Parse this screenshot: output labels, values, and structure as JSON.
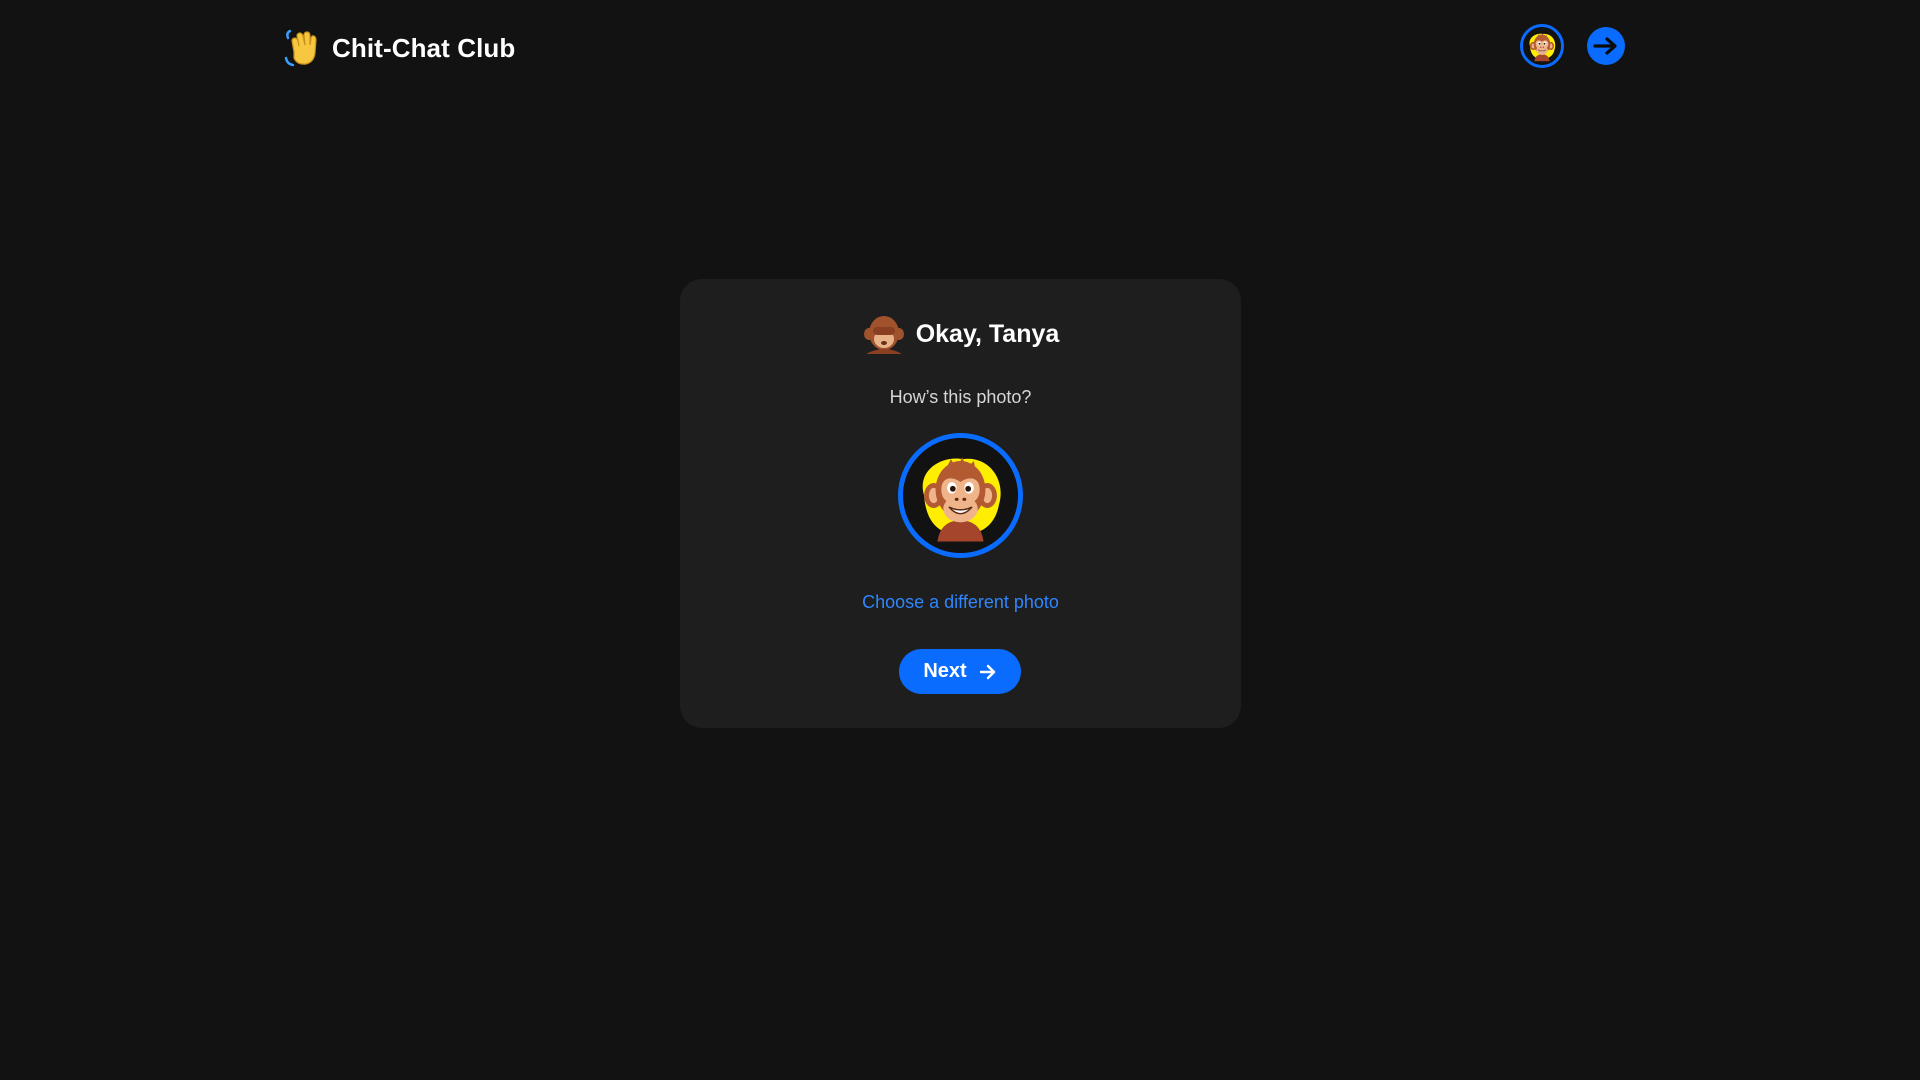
{
  "app": {
    "title": "Chit-Chat Club",
    "logo_icon": "waving-hand-icon"
  },
  "header": {
    "avatar_icon": "monkey-avatar-icon",
    "logout_icon": "sign-out-arrow-icon"
  },
  "card": {
    "heading_icon": "see-no-evil-monkey-icon",
    "title": "Okay, Tanya",
    "subtitle": "How’s this photo?",
    "photo_icon": "monkey-photo",
    "change_photo_label": "Choose a different photo",
    "next_label": "Next",
    "next_icon": "arrow-right-icon"
  },
  "colors": {
    "background": "#121212",
    "card": "#1e1e1e",
    "accent": "#0a6cff",
    "link": "#2f86ff"
  }
}
